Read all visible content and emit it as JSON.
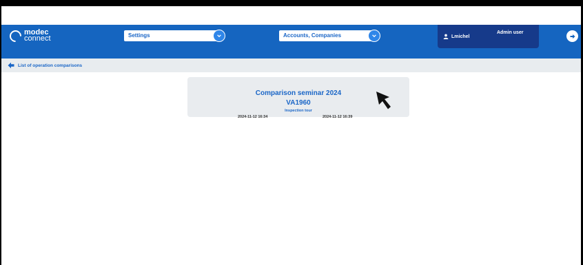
{
  "header": {
    "logo": {
      "line1": "modec",
      "line2": "connect"
    },
    "settings_select": {
      "value": "Settings"
    },
    "accounts_select": {
      "value": "Accounts, Companies"
    },
    "user": {
      "name": "Lmichel",
      "role": "Admin user"
    }
  },
  "subheader": {
    "back_label": "List of operation comparisons"
  },
  "card": {
    "title": "Comparison seminar 2024",
    "code": "VA1960",
    "subtitle": "Inspection tour",
    "date_start": "2024-11-12 16:34",
    "date_end": "2024-11-12 16:39"
  },
  "colors": {
    "primary": "#1565c0",
    "user_panel": "#163a8a",
    "subbar": "#e8ecef",
    "card": "#e9ecef",
    "accent_text": "#1a66c7"
  },
  "icons": [
    "logo-icon",
    "chevron-down-icon",
    "user-icon",
    "logout-icon",
    "arrow-left-icon",
    "mouse-cursor"
  ]
}
